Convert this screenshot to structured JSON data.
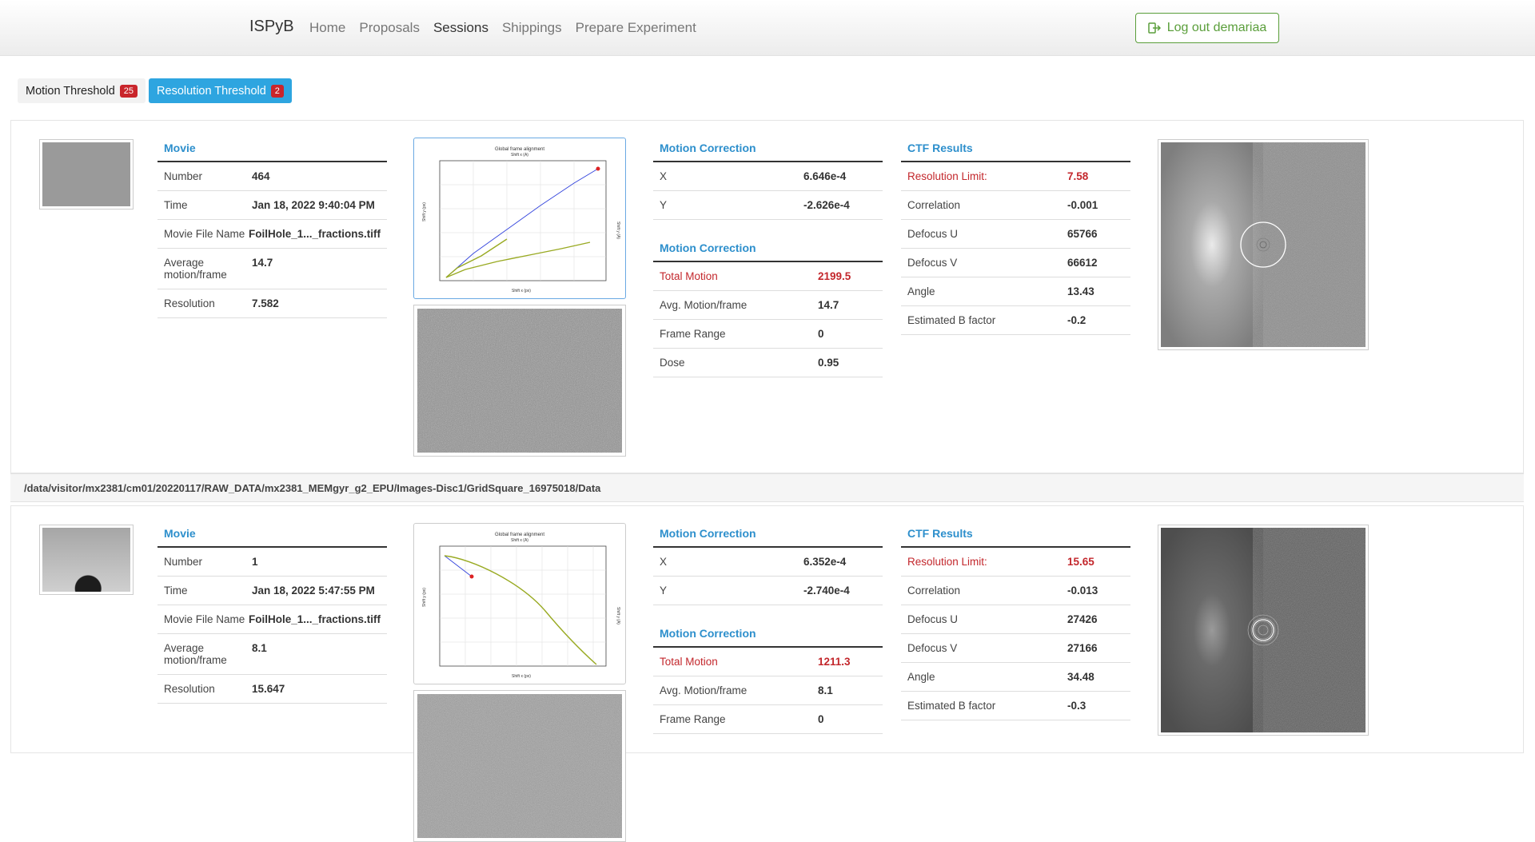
{
  "nav": {
    "brand": "ISPyB",
    "links": [
      "Home",
      "Proposals",
      "Sessions",
      "Shippings",
      "Prepare Experiment"
    ],
    "active": "Sessions",
    "logout": "Log out demariaa"
  },
  "tabs": [
    {
      "label": "Motion Threshold",
      "count": "25"
    },
    {
      "label": "Resolution Threshold",
      "count": "2"
    }
  ],
  "records": [
    {
      "movie": {
        "header": "Movie",
        "rows": [
          {
            "k": "Number",
            "v": "464"
          },
          {
            "k": "Time",
            "v": "Jan 18, 2022 9:40:04 PM"
          },
          {
            "k": "Movie File Name",
            "v": "FoilHole_1..._fractions.tiff"
          },
          {
            "k": "Average motion/frame",
            "v": "14.7"
          },
          {
            "k": "Resolution",
            "v": "7.582"
          }
        ]
      },
      "plot": {
        "title": "Global frame alignment",
        "top_label": "Shift x (A)",
        "x_label": "Shift x (px)",
        "y_label": "Shift y (px)",
        "y2_label": "Shift y (A)"
      },
      "motion1": {
        "header": "Motion Correction",
        "rows": [
          {
            "k": "X",
            "v": "6.646e-4"
          },
          {
            "k": "Y",
            "v": "-2.626e-4"
          }
        ]
      },
      "motion2": {
        "header": "Motion Correction",
        "rows": [
          {
            "k": "Total Motion",
            "v": "2199.5"
          },
          {
            "k": "Avg. Motion/frame",
            "v": "14.7"
          },
          {
            "k": "Frame Range",
            "v": "0"
          },
          {
            "k": "Dose",
            "v": "0.95"
          }
        ]
      },
      "ctf": {
        "header": "CTF Results",
        "rows": [
          {
            "k": "Resolution Limit:",
            "v": "7.58"
          },
          {
            "k": "Correlation",
            "v": "-0.001"
          },
          {
            "k": "Defocus U",
            "v": "65766"
          },
          {
            "k": "Defocus V",
            "v": "66612"
          },
          {
            "k": "Angle",
            "v": "13.43"
          },
          {
            "k": "Estimated B factor",
            "v": "-0.2"
          }
        ]
      }
    },
    {
      "movie": {
        "header": "Movie",
        "rows": [
          {
            "k": "Number",
            "v": "1"
          },
          {
            "k": "Time",
            "v": "Jan 18, 2022 5:47:55 PM"
          },
          {
            "k": "Movie File Name",
            "v": "FoilHole_1..._fractions.tiff"
          },
          {
            "k": "Average motion/frame",
            "v": "8.1"
          },
          {
            "k": "Resolution",
            "v": "15.647"
          }
        ]
      },
      "plot": {
        "title": "Global frame alignment",
        "top_label": "Shift x (A)",
        "x_label": "Shift x (px)",
        "y_label": "Shift y (px)",
        "y2_label": "Shift y (A)"
      },
      "motion1": {
        "header": "Motion Correction",
        "rows": [
          {
            "k": "X",
            "v": "6.352e-4"
          },
          {
            "k": "Y",
            "v": "-2.740e-4"
          }
        ]
      },
      "motion2": {
        "header": "Motion Correction",
        "rows": [
          {
            "k": "Total Motion",
            "v": "1211.3"
          },
          {
            "k": "Avg. Motion/frame",
            "v": "8.1"
          },
          {
            "k": "Frame Range",
            "v": "0"
          }
        ]
      },
      "ctf": {
        "header": "CTF Results",
        "rows": [
          {
            "k": "Resolution Limit:",
            "v": "15.65"
          },
          {
            "k": "Correlation",
            "v": "-0.013"
          },
          {
            "k": "Defocus U",
            "v": "27426"
          },
          {
            "k": "Defocus V",
            "v": "27166"
          },
          {
            "k": "Angle",
            "v": "34.48"
          },
          {
            "k": "Estimated B factor",
            "v": "-0.3"
          }
        ]
      }
    }
  ],
  "path": "/data/visitor/mx2381/cm01/20220117/RAW_DATA/mx2381_MEMgyr_g2_EPU/Images-Disc1/GridSquare_16975018/Data",
  "colors": {
    "accent": "#2ea5e0",
    "danger": "#c3272c",
    "success": "#5a9e3a"
  }
}
